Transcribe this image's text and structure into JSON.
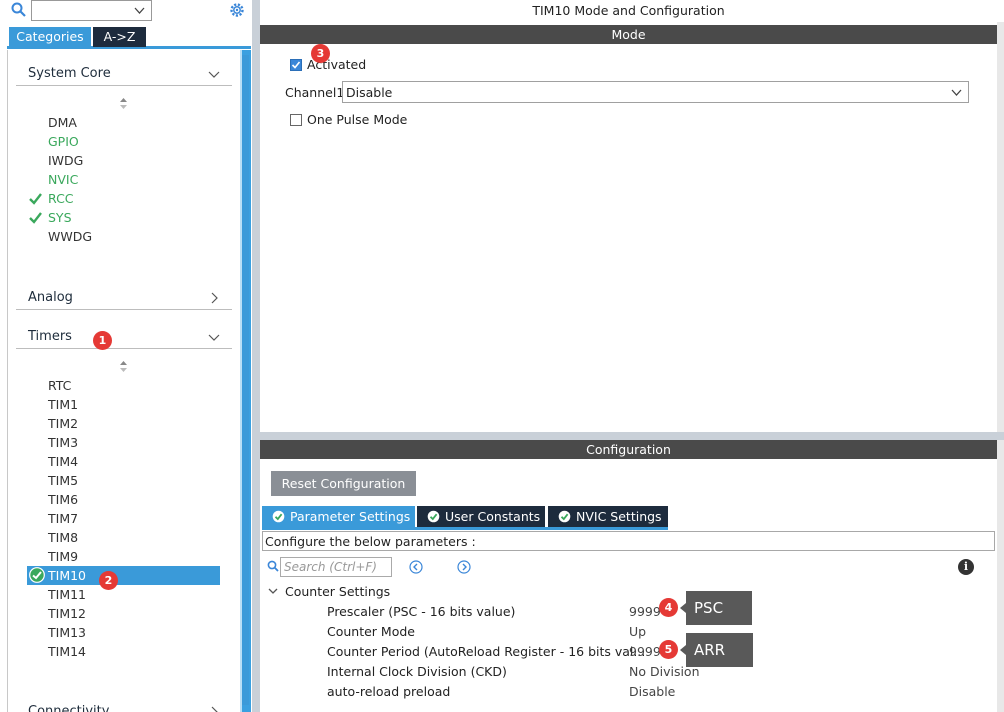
{
  "left_panel": {
    "search_value": "",
    "tabs": {
      "categories": "Categories",
      "az": "A->Z"
    },
    "categories": [
      {
        "label": "System Core",
        "expanded": true
      },
      {
        "label": "Analog",
        "expanded": false
      },
      {
        "label": "Timers",
        "expanded": true
      },
      {
        "label": "Connectivity",
        "expanded": false
      }
    ],
    "system_core_items": [
      {
        "label": "DMA",
        "state": "normal"
      },
      {
        "label": "GPIO",
        "state": "configured"
      },
      {
        "label": "IWDG",
        "state": "normal"
      },
      {
        "label": "NVIC",
        "state": "configured"
      },
      {
        "label": "RCC",
        "state": "checked"
      },
      {
        "label": "SYS",
        "state": "checked"
      },
      {
        "label": "WWDG",
        "state": "normal"
      }
    ],
    "timer_items": [
      "RTC",
      "TIM1",
      "TIM2",
      "TIM3",
      "TIM4",
      "TIM5",
      "TIM6",
      "TIM7",
      "TIM8",
      "TIM9",
      "TIM10",
      "TIM11",
      "TIM12",
      "TIM13",
      "TIM14"
    ],
    "selected_timer": "TIM10"
  },
  "badges": {
    "b1": "1",
    "b2": "2",
    "b3": "3",
    "b4": "4",
    "b5": "5"
  },
  "mode_panel": {
    "title": "TIM10 Mode and Configuration",
    "mode_header": "Mode",
    "activated_label": "Activated",
    "activated_checked": true,
    "channel1_label": "Channel1",
    "channel1_value": "Disable",
    "one_pulse_label": "One Pulse Mode",
    "one_pulse_checked": false
  },
  "config_panel": {
    "header": "Configuration",
    "reset_button": "Reset Configuration",
    "tabs": [
      "Parameter Settings",
      "User Constants",
      "NVIC Settings"
    ],
    "description": "Configure the below parameters :",
    "search_placeholder": "Search (Ctrl+F)",
    "group": "Counter Settings",
    "params": [
      {
        "name": "Prescaler (PSC - 16 bits value)",
        "value": "9999"
      },
      {
        "name": "Counter Mode",
        "value": "Up"
      },
      {
        "name": "Counter Period (AutoReload Register - 16 bits val...",
        "value": "9999"
      },
      {
        "name": "Internal Clock Division (CKD)",
        "value": "No Division"
      },
      {
        "name": "auto-reload preload",
        "value": "Disable"
      }
    ]
  },
  "callouts": {
    "psc": "PSC",
    "arr": "ARR"
  },
  "colors": {
    "accent": "#3a9ad9",
    "configured": "#3aa85c",
    "badge": "#e53935",
    "header_bar": "#4a4a4a",
    "dark_tab": "#1d2b3d"
  }
}
